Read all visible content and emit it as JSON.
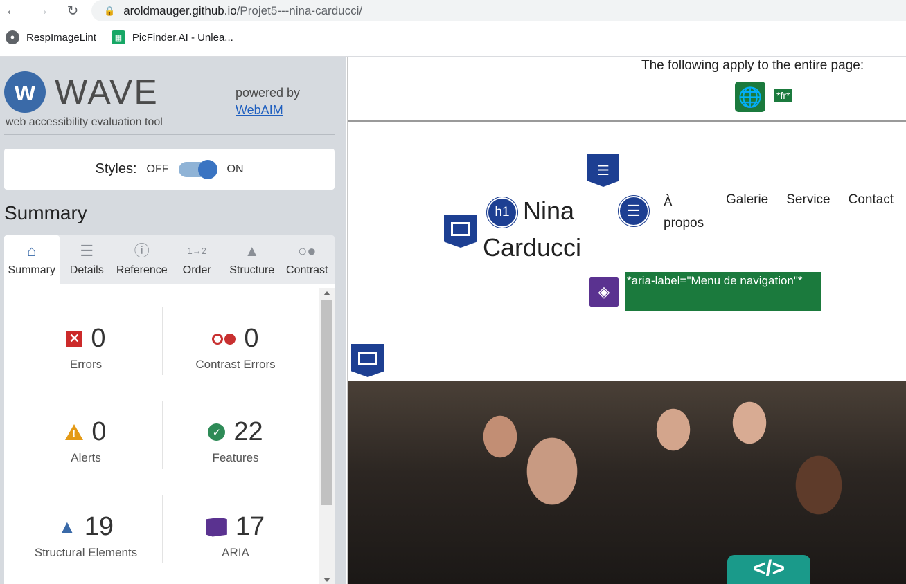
{
  "browser": {
    "url_host": "aroldmauger.github.io",
    "url_path": "/Projet5---nina-carducci/",
    "bookmarks": [
      {
        "label": "RespImageLint",
        "icon": "globe-icon"
      },
      {
        "label": "PicFinder.AI - Unlea...",
        "icon": "picfinder-icon"
      }
    ]
  },
  "wave": {
    "logo_word": "WAVE",
    "logo_sub": "web accessibility evaluation tool",
    "powered_by": "powered by",
    "webaim_link": "WebAIM",
    "styles_label": "Styles:",
    "toggle_off": "OFF",
    "toggle_on": "ON",
    "summary_heading": "Summary",
    "tabs": [
      {
        "label": "Summary",
        "icon": "home-icon",
        "active": true
      },
      {
        "label": "Details",
        "icon": "list-icon",
        "active": false
      },
      {
        "label": "Reference",
        "icon": "info-icon",
        "active": false
      },
      {
        "label": "Order",
        "icon": "order-icon",
        "active": false
      },
      {
        "label": "Structure",
        "icon": "structure-icon",
        "active": false
      },
      {
        "label": "Contrast",
        "icon": "contrast-icon",
        "active": false
      }
    ],
    "stats": [
      {
        "label": "Errors",
        "value": "0",
        "icon": "error-icon"
      },
      {
        "label": "Contrast Errors",
        "value": "0",
        "icon": "contrast-error-icon"
      },
      {
        "label": "Alerts",
        "value": "0",
        "icon": "alert-icon"
      },
      {
        "label": "Features",
        "value": "22",
        "icon": "feature-icon"
      },
      {
        "label": "Structural Elements",
        "value": "19",
        "icon": "structure-icon"
      },
      {
        "label": "ARIA",
        "value": "17",
        "icon": "aria-icon"
      }
    ],
    "colors": {
      "accent": "#3a6aa8",
      "error": "#cc2a2a",
      "alert": "#e49a15",
      "feature": "#2e8b57",
      "aria": "#5a3290"
    }
  },
  "page": {
    "applies_text": "The following apply to the entire page:",
    "lang_tag": "*fr*",
    "h1_badge": "h1",
    "site_title_line1": "Nina",
    "site_title_line2": "Carducci",
    "nav": [
      "À propos",
      "Galerie",
      "Service",
      "Contact"
    ],
    "aria_label": "*aria-label=\"Menu de navigation\"*",
    "code_badge": "</>"
  }
}
